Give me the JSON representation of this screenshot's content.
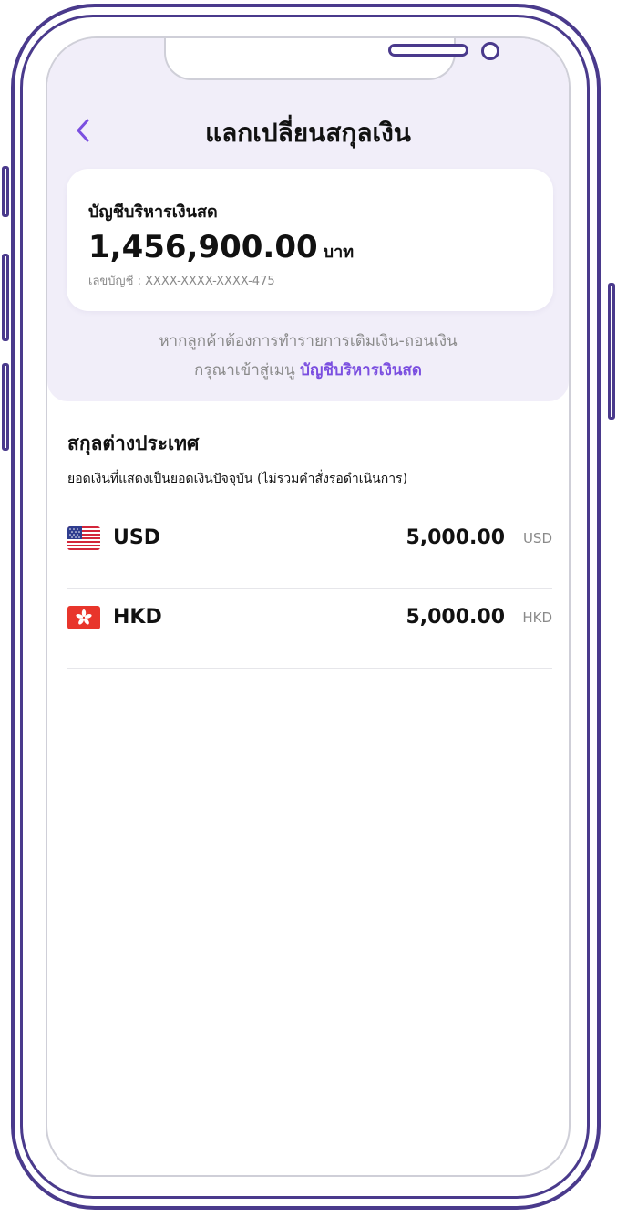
{
  "header": {
    "title": "แลกเปลี่ยนสกุลเงิน"
  },
  "cash_account": {
    "label": "บัญชีบริหารเงินสด",
    "amount": "1,456,900.00",
    "unit": "บาท",
    "account_number": "เลขบัญชี : XXXX-XXXX-XXXX-475"
  },
  "hint": {
    "line1": "หากลูกค้าต้องการทำรายการเติมเงิน-ถอนเงิน",
    "line2_prefix": "กรุณาเข้าสู่เมนู ",
    "line2_link": "บัญชีบริหารเงินสด"
  },
  "foreign": {
    "title": "สกุลต่างประเทศ",
    "subtitle": "ยอดเงินที่แสดงเป็นยอดเงินปัจจุบัน (ไม่รวมคำสั่งรอดำเนินการ)",
    "items": [
      {
        "code": "USD",
        "amount": "5,000.00",
        "unit": "USD",
        "flag_icon": "us-flag-icon"
      },
      {
        "code": "HKD",
        "amount": "5,000.00",
        "unit": "HKD",
        "flag_icon": "hk-flag-icon"
      }
    ]
  },
  "colors": {
    "accent": "#7b4fe0",
    "frame": "#4a3a8c",
    "header_bg": "#f1eef9"
  }
}
